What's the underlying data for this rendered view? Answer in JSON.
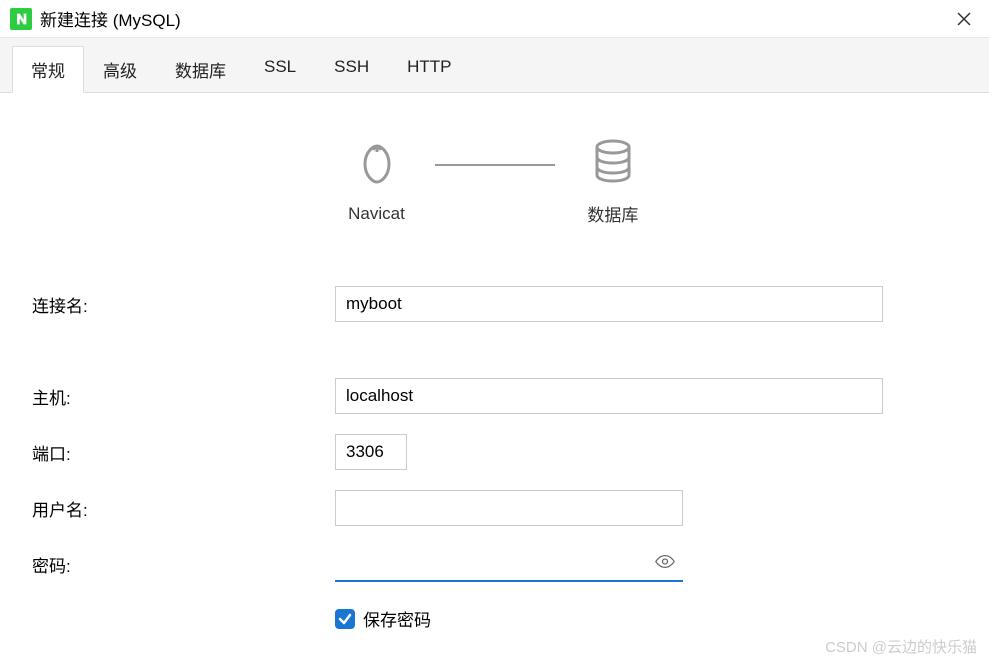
{
  "titlebar": {
    "title": "新建连接 (MySQL)"
  },
  "tabs": {
    "items": [
      {
        "label": "常规",
        "active": true
      },
      {
        "label": "高级",
        "active": false
      },
      {
        "label": "数据库",
        "active": false
      },
      {
        "label": "SSL",
        "active": false
      },
      {
        "label": "SSH",
        "active": false
      },
      {
        "label": "HTTP",
        "active": false
      }
    ]
  },
  "diagram": {
    "left_label": "Navicat",
    "right_label": "数据库"
  },
  "form": {
    "connection_name": {
      "label": "连接名:",
      "value": "myboot"
    },
    "host": {
      "label": "主机:",
      "value": "localhost"
    },
    "port": {
      "label": "端口:",
      "value": "3306"
    },
    "username": {
      "label": "用户名:",
      "value": ""
    },
    "password": {
      "label": "密码:",
      "value": ""
    },
    "save_password": {
      "label": "保存密码",
      "checked": true
    }
  },
  "watermark": "CSDN @云边的快乐猫"
}
